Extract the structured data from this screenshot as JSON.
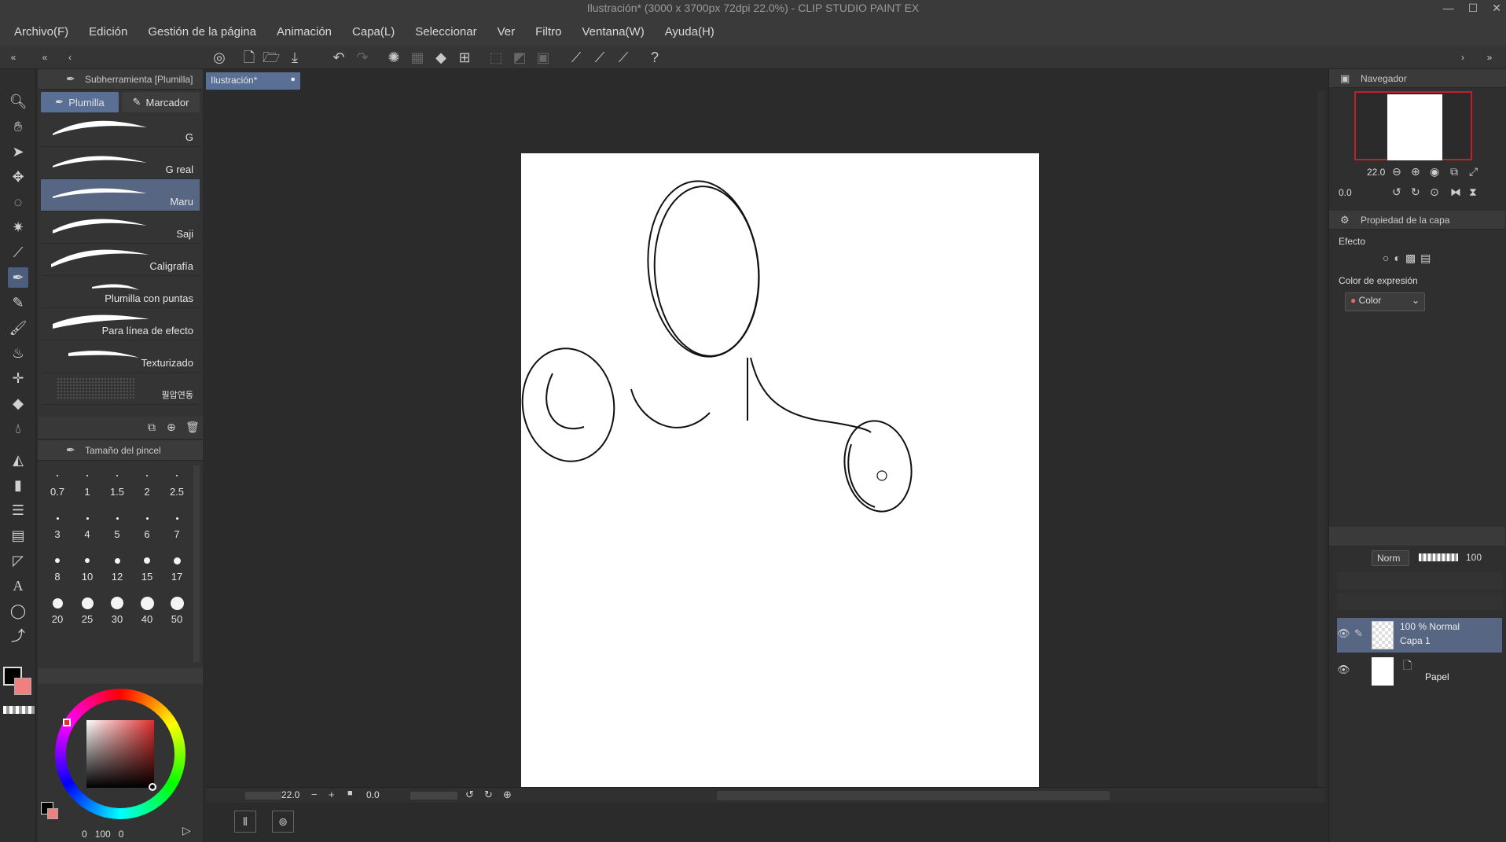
{
  "window": {
    "title": "Ilustración* (3000 x 3700px 72dpi 22.0%)  - CLIP STUDIO PAINT EX",
    "controls": [
      "—",
      "☐",
      "✕"
    ]
  },
  "menu": [
    "Archivo(F)",
    "Edición",
    "Gestión de la página",
    "Animación",
    "Capa(L)",
    "Seleccionar",
    "Ver",
    "Filtro",
    "Ventana(W)",
    "Ayuda(H)"
  ],
  "subtool_panel": {
    "title": "Subherramienta [Plumilla]",
    "tabs": [
      {
        "label": "Plumilla",
        "active": true
      },
      {
        "label": "Marcador",
        "active": false
      }
    ],
    "brushes": [
      {
        "name": "G",
        "active": false
      },
      {
        "name": "G real",
        "active": false
      },
      {
        "name": "Maru",
        "active": true
      },
      {
        "name": "Saji",
        "active": false
      },
      {
        "name": "Caligrafía",
        "active": false
      },
      {
        "name": "Plumilla con puntas",
        "active": false
      },
      {
        "name": "Para línea de efecto",
        "active": false
      },
      {
        "name": "Texturizado",
        "active": false
      },
      {
        "name": "필압연동",
        "active": false
      }
    ]
  },
  "brush_size_panel": {
    "title": "Tamaño del pincel",
    "sizes": [
      "0.7",
      "1",
      "1.5",
      "2",
      "2.5",
      "3",
      "4",
      "5",
      "6",
      "7",
      "8",
      "10",
      "12",
      "15",
      "17",
      "20",
      "25",
      "30",
      "40",
      "50"
    ]
  },
  "color_panel": {
    "values": [
      "0",
      "100",
      "0"
    ]
  },
  "document": {
    "tab_label": "Ilustración*",
    "zoom": "22.0",
    "rotation": "0.0"
  },
  "navigator": {
    "title": "Navegador",
    "zoom": "22.0",
    "rotation": "0.0"
  },
  "layer_property": {
    "title": "Propiedad de la capa",
    "effect_label": "Efecto",
    "expression_color_label": "Color de expresión",
    "expression_color_value": "Color"
  },
  "layers_panel": {
    "blend_mode": "Norm",
    "opacity": "100",
    "layers": [
      {
        "line1": "100 % Normal",
        "line2": "Capa 1",
        "active": true
      },
      {
        "line1": "",
        "line2": "Papel",
        "active": false
      }
    ]
  },
  "colors": {
    "accent": "#566683",
    "panel_bg": "#333333",
    "canvas_bg": "#2b2b2b",
    "paper": "#ffffff",
    "nav_frame": "#c0202a",
    "main_color": "#000000",
    "sub_color": "#f08080"
  }
}
